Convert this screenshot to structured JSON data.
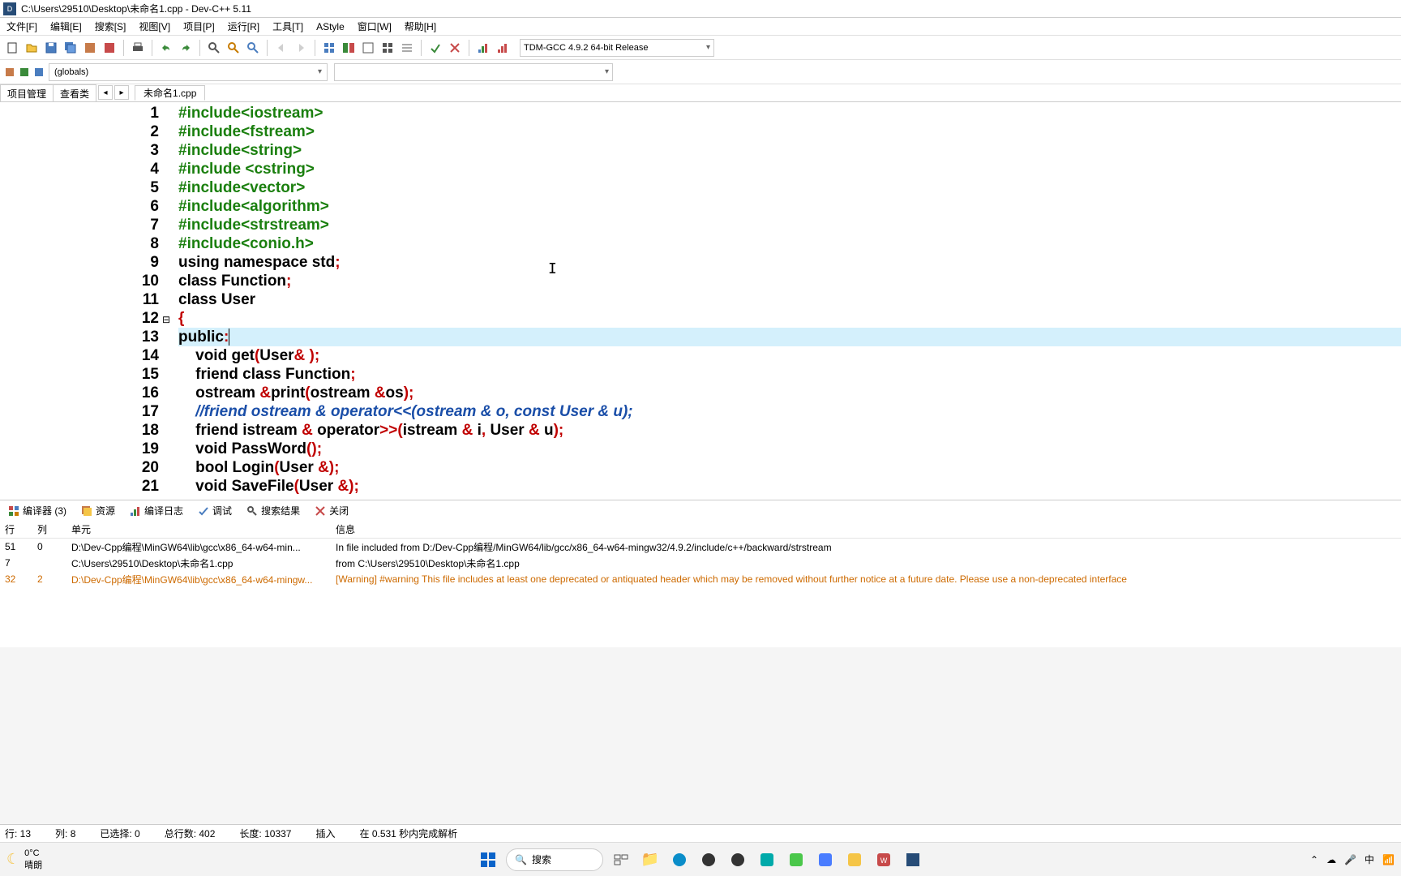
{
  "window": {
    "title": "C:\\Users\\29510\\Desktop\\未命名1.cpp - Dev-C++ 5.11"
  },
  "menu": {
    "items": [
      "文件[F]",
      "编辑[E]",
      "搜索[S]",
      "视图[V]",
      "项目[P]",
      "运行[R]",
      "工具[T]",
      "AStyle",
      "窗口[W]",
      "帮助[H]"
    ]
  },
  "toolbar": {
    "compiler": "TDM-GCC 4.9.2 64-bit Release"
  },
  "toolbar2": {
    "scope": "(globals)"
  },
  "left_tabs": [
    "项目管理",
    "查看类"
  ],
  "file_tab": "未命名1.cpp",
  "code": {
    "lines": [
      {
        "n": "1",
        "html": "<span class='prep'>#include&lt;iostream&gt;</span>"
      },
      {
        "n": "2",
        "html": "<span class='prep'>#include&lt;fstream&gt;</span>"
      },
      {
        "n": "3",
        "html": "<span class='prep'>#include&lt;string&gt;</span>"
      },
      {
        "n": "4",
        "html": "<span class='prep'>#include &lt;cstring&gt;</span>"
      },
      {
        "n": "5",
        "html": "<span class='prep'>#include&lt;vector&gt;</span>"
      },
      {
        "n": "6",
        "html": "<span class='prep'>#include&lt;algorithm&gt;</span>"
      },
      {
        "n": "7",
        "html": "<span class='prep'>#include&lt;strstream&gt;</span>"
      },
      {
        "n": "8",
        "html": "<span class='prep'>#include&lt;conio.h&gt;</span>"
      },
      {
        "n": "9",
        "html": "<span class='kw'>using namespace</span> <span class='ident'>std</span><span class='punct'>;</span>"
      },
      {
        "n": "10",
        "html": "<span class='kw'>class</span> <span class='ident'>Function</span><span class='punct'>;</span>"
      },
      {
        "n": "11",
        "html": "<span class='kw'>class</span> <span class='ident'>User</span>"
      },
      {
        "n": "12",
        "fold": "⊟",
        "html": "<span class='punct'>{</span>"
      },
      {
        "n": "13",
        "hl": true,
        "html": "<span class='kw'>public</span><span class='punct'>:</span><span style='border-left:1px solid #000;'></span>"
      },
      {
        "n": "14",
        "html": "    <span class='kw'>void</span> <span class='ident'>get</span><span class='punct'>(</span><span class='ident'>User</span><span class='punct'>&amp; );</span>"
      },
      {
        "n": "15",
        "html": "    <span class='kw'>friend class</span> <span class='ident'>Function</span><span class='punct'>;</span>"
      },
      {
        "n": "16",
        "html": "    <span class='ident'>ostream</span> <span class='punct'>&amp;</span><span class='ident'>print</span><span class='punct'>(</span><span class='ident'>ostream</span> <span class='punct'>&amp;</span><span class='ident'>os</span><span class='punct'>);</span>"
      },
      {
        "n": "17",
        "html": "    <span class='comment'>//friend ostream &amp; operator&lt;&lt;(ostream &amp; o, const User &amp; u);</span>"
      },
      {
        "n": "18",
        "html": "    <span class='kw'>friend</span> <span class='ident'>istream</span> <span class='punct'>&amp;</span> <span class='kw'>operator</span><span class='punct'>&gt;&gt;(</span><span class='ident'>istream</span> <span class='punct'>&amp;</span> <span class='ident'>i</span><span class='punct'>,</span> <span class='ident'>User</span> <span class='punct'>&amp;</span> <span class='ident'>u</span><span class='punct'>);</span>"
      },
      {
        "n": "19",
        "html": "    <span class='kw'>void</span> <span class='ident'>PassWord</span><span class='punct'>();</span>"
      },
      {
        "n": "20",
        "html": "    <span class='kw'>bool</span> <span class='ident'>Login</span><span class='punct'>(</span><span class='ident'>User</span> <span class='punct'>&amp;);</span>"
      },
      {
        "n": "21",
        "html": "    <span class='kw'>void</span> <span class='ident'>SaveFile</span><span class='punct'>(</span><span class='ident'>User</span> <span class='punct'>&amp;);</span>"
      }
    ]
  },
  "bottom_tabs": {
    "compiler": "编译器 (3)",
    "resources": "资源",
    "log": "编译日志",
    "debug": "调试",
    "search": "搜索结果",
    "close": "关闭"
  },
  "compiler_output": {
    "headers": {
      "line": "行",
      "col": "列",
      "unit": "单元",
      "msg": "信息"
    },
    "rows": [
      {
        "line": "51",
        "col": "0",
        "unit": "D:\\Dev-Cpp编程\\MinGW64\\lib\\gcc\\x86_64-w64-min...",
        "msg": "In file included from D:/Dev-Cpp编程/MinGW64/lib/gcc/x86_64-w64-mingw32/4.9.2/include/c++/backward/strstream",
        "warn": false
      },
      {
        "line": "7",
        "col": "",
        "unit": "C:\\Users\\29510\\Desktop\\未命名1.cpp",
        "msg": "                 from C:\\Users\\29510\\Desktop\\未命名1.cpp",
        "warn": false
      },
      {
        "line": "32",
        "col": "2",
        "unit": "D:\\Dev-Cpp编程\\MinGW64\\lib\\gcc\\x86_64-w64-mingw...",
        "msg": "[Warning] #warning This file includes at least one deprecated or antiquated header which may be removed without further notice at a future date. Please use a non-deprecated interface",
        "warn": true
      }
    ]
  },
  "status_bar": {
    "line": "行:   13",
    "col": "列:   8",
    "sel": "已选择:   0",
    "total": "总行数:   402",
    "len": "长度:   10337",
    "mode": "插入",
    "parse": "在 0.531 秒内完成解析"
  },
  "taskbar": {
    "temp": "0°C",
    "weather": "晴朗",
    "search_placeholder": "搜索",
    "ime": "中"
  }
}
